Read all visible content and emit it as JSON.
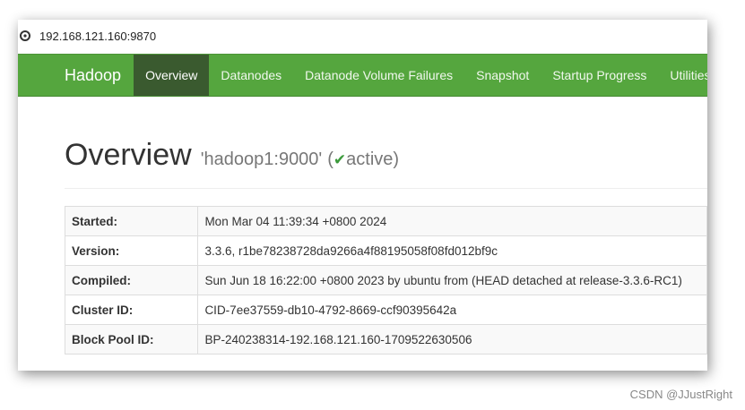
{
  "address_bar": {
    "icon": "page-info-icon",
    "url": "192.168.121.160:9870"
  },
  "navbar": {
    "brand": "Hadoop",
    "items": [
      {
        "label": "Overview",
        "active": true
      },
      {
        "label": "Datanodes",
        "active": false
      },
      {
        "label": "Datanode Volume Failures",
        "active": false
      },
      {
        "label": "Snapshot",
        "active": false
      },
      {
        "label": "Startup Progress",
        "active": false
      },
      {
        "label": "Utilities",
        "active": false,
        "dropdown": true
      }
    ],
    "colors": {
      "bar": "#55a63e",
      "active": "#3a5a2f"
    }
  },
  "header": {
    "title": "Overview",
    "host": "'hadoop1:9000'",
    "status_open": "(",
    "status": "active",
    "status_close": ")",
    "status_icon": "check-icon"
  },
  "info_table": {
    "rows": [
      {
        "key": "Started:",
        "value": "Mon Mar 04 11:39:34 +0800 2024"
      },
      {
        "key": "Version:",
        "value": "3.3.6, r1be78238728da9266a4f88195058f08fd012bf9c"
      },
      {
        "key": "Compiled:",
        "value": "Sun Jun 18 16:22:00 +0800 2023 by ubuntu from (HEAD detached at release-3.3.6-RC1)"
      },
      {
        "key": "Cluster ID:",
        "value": "CID-7ee37559-db10-4792-8669-ccf90395642a"
      },
      {
        "key": "Block Pool ID:",
        "value": "BP-240238314-192.168.121.160-1709522630506"
      }
    ]
  },
  "watermark": "CSDN @JJustRight"
}
